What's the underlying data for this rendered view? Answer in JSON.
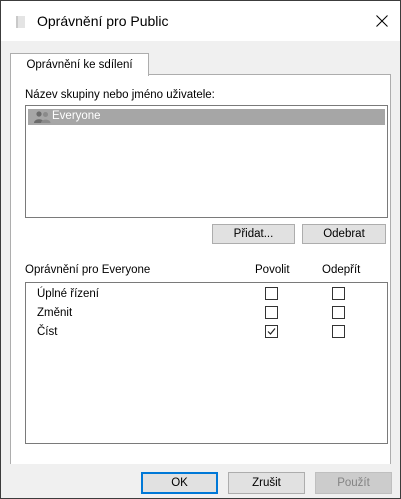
{
  "window": {
    "title": "Oprávnění pro Public",
    "close_icon": "close-icon"
  },
  "tab": {
    "label": "Oprávnění ke sdílení"
  },
  "group_section": {
    "label": "Název skupiny nebo jméno uživatele:",
    "items": [
      {
        "name": "Everyone",
        "icon": "users-icon",
        "selected": true
      }
    ]
  },
  "buttons": {
    "add": "Přidat...",
    "remove": "Odebrat"
  },
  "permissions": {
    "title": "Oprávnění pro Everyone",
    "allow_header": "Povolit",
    "deny_header": "Odepřít",
    "rows": [
      {
        "label": "Úplné řízení",
        "allow": false,
        "deny": false
      },
      {
        "label": "Změnit",
        "allow": false,
        "deny": false
      },
      {
        "label": "Číst",
        "allow": true,
        "deny": false
      }
    ]
  },
  "footer": {
    "ok": "OK",
    "cancel": "Zrušit",
    "apply": "Použít"
  },
  "colors": {
    "selection": "#a6a6a6",
    "default_button_border": "#0078d7"
  }
}
